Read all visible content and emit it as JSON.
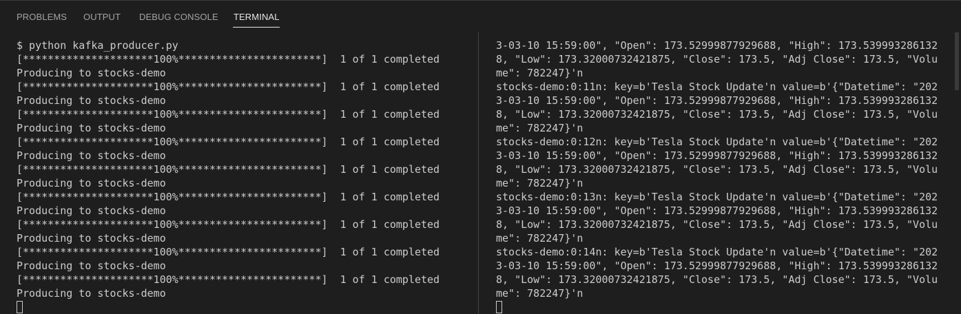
{
  "tabs": [
    {
      "label": "PROBLEMS"
    },
    {
      "label": "OUTPUT"
    },
    {
      "label": "DEBUG CONSOLE"
    },
    {
      "label": "TERMINAL"
    }
  ],
  "active_tab": "TERMINAL",
  "left_terminal": {
    "lines": [
      "$ python kafka_producer.py",
      "[*********************100%***********************]  1 of 1 completed",
      "Producing to stocks-demo",
      "[*********************100%***********************]  1 of 1 completed",
      "Producing to stocks-demo",
      "[*********************100%***********************]  1 of 1 completed",
      "Producing to stocks-demo",
      "[*********************100%***********************]  1 of 1 completed",
      "Producing to stocks-demo",
      "[*********************100%***********************]  1 of 1 completed",
      "Producing to stocks-demo",
      "[*********************100%***********************]  1 of 1 completed",
      "Producing to stocks-demo",
      "[*********************100%***********************]  1 of 1 completed",
      "Producing to stocks-demo",
      "[*********************100%***********************]  1 of 1 completed",
      "Producing to stocks-demo",
      "[*********************100%***********************]  1 of 1 completed",
      "Producing to stocks-demo"
    ]
  },
  "right_terminal": {
    "lines": [
      "3-03-10 15:59:00\", \"Open\": 173.52999877929688, \"High\": 173.539993286132",
      "8, \"Low\": 173.32000732421875, \"Close\": 173.5, \"Adj Close\": 173.5, \"Volu",
      "me\": 782247}'n",
      "stocks-demo:0:11n: key=b'Tesla Stock Update'n value=b'{\"Datetime\": \"202",
      "3-03-10 15:59:00\", \"Open\": 173.52999877929688, \"High\": 173.539993286132",
      "8, \"Low\": 173.32000732421875, \"Close\": 173.5, \"Adj Close\": 173.5, \"Volu",
      "me\": 782247}'n",
      "stocks-demo:0:12n: key=b'Tesla Stock Update'n value=b'{\"Datetime\": \"202",
      "3-03-10 15:59:00\", \"Open\": 173.52999877929688, \"High\": 173.539993286132",
      "8, \"Low\": 173.32000732421875, \"Close\": 173.5, \"Adj Close\": 173.5, \"Volu",
      "me\": 782247}'n",
      "stocks-demo:0:13n: key=b'Tesla Stock Update'n value=b'{\"Datetime\": \"202",
      "3-03-10 15:59:00\", \"Open\": 173.52999877929688, \"High\": 173.539993286132",
      "8, \"Low\": 173.32000732421875, \"Close\": 173.5, \"Adj Close\": 173.5, \"Volu",
      "me\": 782247}'n",
      "stocks-demo:0:14n: key=b'Tesla Stock Update'n value=b'{\"Datetime\": \"202",
      "3-03-10 15:59:00\", \"Open\": 173.52999877929688, \"High\": 173.539993286132",
      "8, \"Low\": 173.32000732421875, \"Close\": 173.5, \"Adj Close\": 173.5, \"Volu",
      "me\": 782247}'n"
    ]
  },
  "colors": {
    "background": "#1e1e1e",
    "text": "#cccccc",
    "tab_inactive": "#a4a4a4",
    "tab_active": "#e7e7e7",
    "divider": "#444444"
  }
}
